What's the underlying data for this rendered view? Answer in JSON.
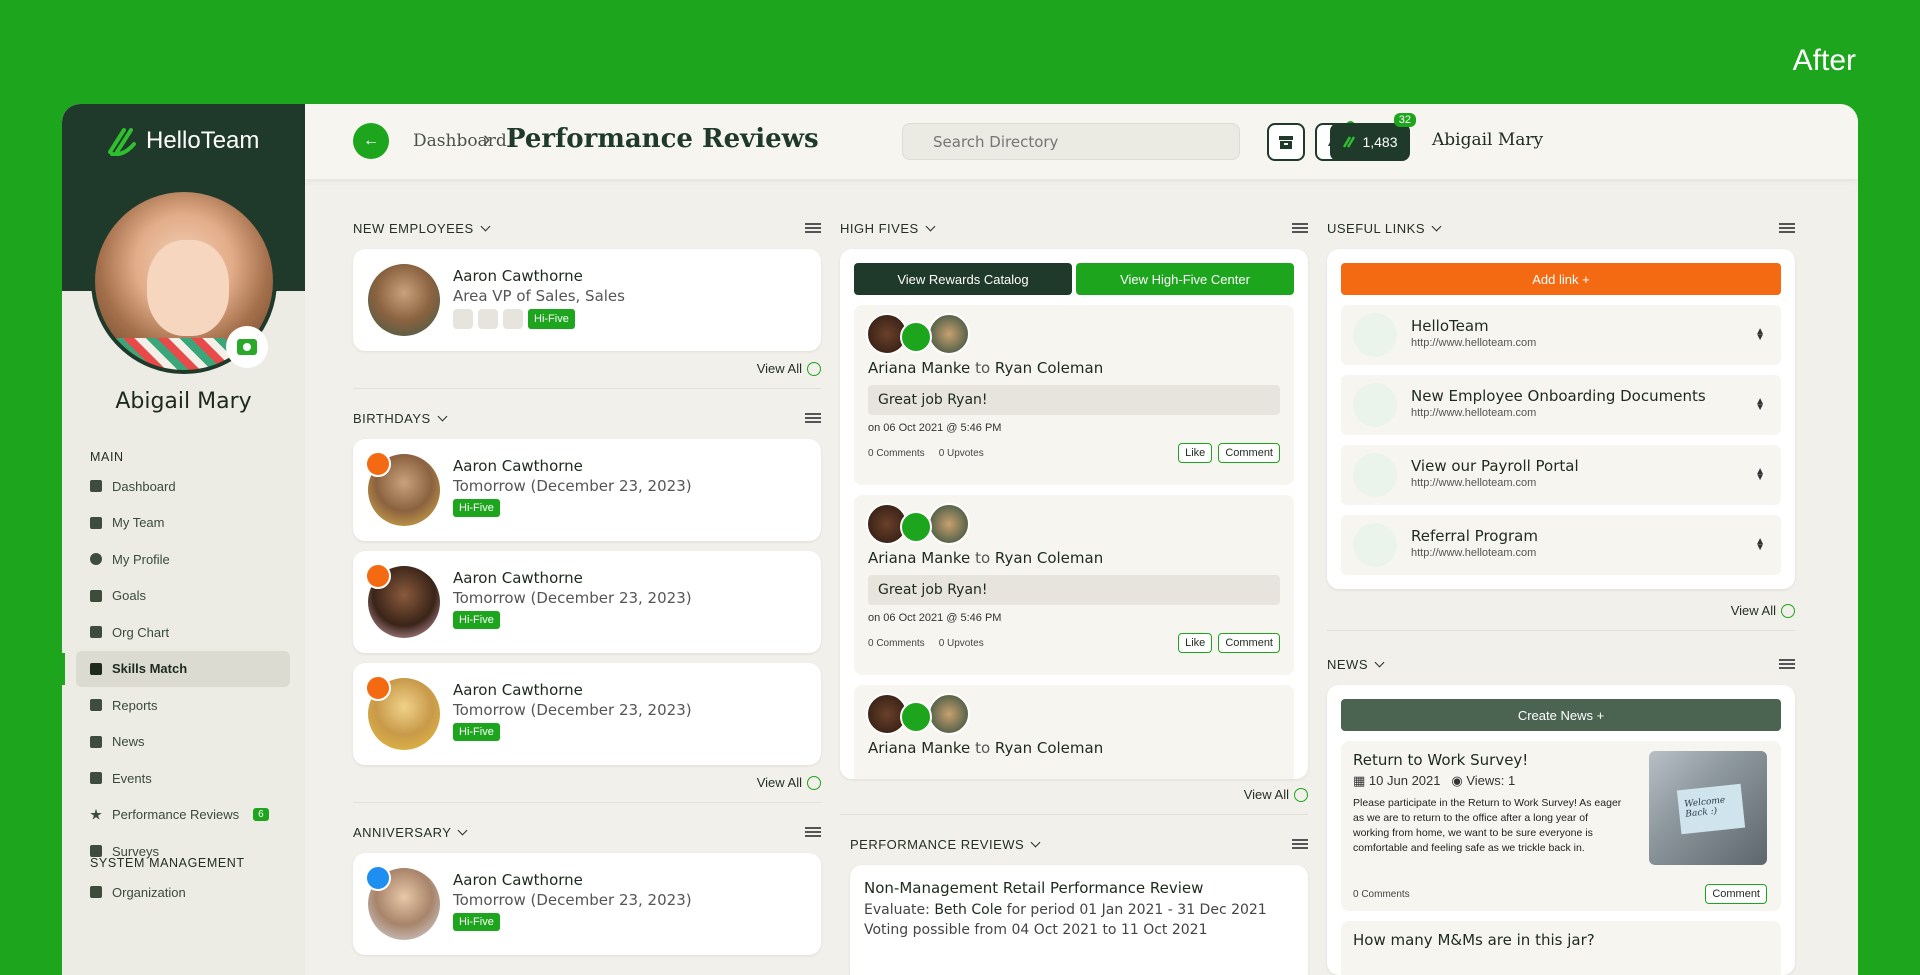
{
  "after_label": "After",
  "app": {
    "name": "HelloTeam"
  },
  "profile": {
    "name": "Abigail Mary"
  },
  "sidebar": {
    "main_title": "MAIN",
    "items": [
      {
        "label": "Dashboard",
        "icon": "home-icon"
      },
      {
        "label": "My Team",
        "icon": "team-icon"
      },
      {
        "label": "My Profile",
        "icon": "profile-icon"
      },
      {
        "label": "Goals",
        "icon": "flag-icon"
      },
      {
        "label": "Org Chart",
        "icon": "org-chart-icon"
      },
      {
        "label": "Skills Match",
        "icon": "puzzle-icon",
        "active": true
      },
      {
        "label": "Reports",
        "icon": "report-icon"
      },
      {
        "label": "News",
        "icon": "megaphone-icon"
      },
      {
        "label": "Events",
        "icon": "calendar-icon"
      },
      {
        "label": "Performance Reviews",
        "icon": "star-icon",
        "badge": "6"
      },
      {
        "label": "Surveys",
        "icon": "survey-icon"
      }
    ],
    "system_title": "SYSTEM MANAGEMENT",
    "system_items": [
      {
        "label": "Organization",
        "icon": "home-icon"
      }
    ]
  },
  "topbar": {
    "breadcrumb": "Dashboard",
    "title": "Performance Reviews",
    "search_placeholder": "Search Directory",
    "points": "1,483",
    "points_badge": "32",
    "user": "Abigail Mary"
  },
  "new_employees": {
    "title": "NEW EMPLOYEES",
    "person": {
      "name": "Aaron Cawthorne",
      "role": "Area VP of Sales, Sales",
      "hifive": "Hi-Five"
    },
    "view_all": "View All"
  },
  "birthdays": {
    "title": "BIRTHDAYS",
    "people": [
      {
        "name": "Aaron Cawthorne",
        "when": "Tomorrow (December 23, 2023)",
        "hifive": "Hi-Five"
      },
      {
        "name": "Aaron Cawthorne",
        "when": "Tomorrow (December 23, 2023)",
        "hifive": "Hi-Five"
      },
      {
        "name": "Aaron Cawthorne",
        "when": "Tomorrow (December 23, 2023)",
        "hifive": "Hi-Five"
      }
    ],
    "view_all": "View All"
  },
  "anniversary": {
    "title": "ANNIVERSARY",
    "person": {
      "name": "Aaron Cawthorne",
      "when": "Tomorrow (December 23, 2023)",
      "hifive": "Hi-Five"
    }
  },
  "high_fives": {
    "title": "HIGH FIVES",
    "btn_rewards": "View Rewards Catalog",
    "btn_center": "View High-Five Center",
    "items": [
      {
        "from": "Ariana Manke",
        "to": "Ryan Coleman",
        "message": "Great job Ryan!",
        "date": "on 06 Oct 2021 @ 5:46 PM",
        "comments": "0 Comments",
        "upvotes": "0 Upvotes"
      },
      {
        "from": "Ariana Manke",
        "to": "Ryan Coleman",
        "message": "Great job Ryan!",
        "date": "on 06 Oct 2021 @ 5:46 PM",
        "comments": "0 Comments",
        "upvotes": "0 Upvotes"
      },
      {
        "from": "Ariana Manke",
        "to": "Ryan Coleman"
      }
    ],
    "to_word": "to",
    "like": "Like",
    "comment": "Comment",
    "view_all": "View All"
  },
  "performance_reviews": {
    "title": "PERFORMANCE REVIEWS",
    "review_title": "Non-Management Retail Performance Review",
    "evaluate_prefix": "Evaluate:",
    "evaluate_name": "Beth Cole",
    "evaluate_suffix": "for period 01 Jan 2021 - 31 Dec 2021",
    "voting": "Voting possible from 04 Oct 2021 to 11 Oct 2021"
  },
  "useful_links": {
    "title": "USEFUL LINKS",
    "add": "Add link +",
    "links": [
      {
        "title": "HelloTeam",
        "url": "http://www.helloteam.com"
      },
      {
        "title": "New Employee Onboarding Documents",
        "url": "http://www.helloteam.com"
      },
      {
        "title": "View our Payroll Portal",
        "url": "http://www.helloteam.com"
      },
      {
        "title": "Referral Program",
        "url": "http://www.helloteam.com"
      }
    ],
    "view_all": "View All"
  },
  "news": {
    "title": "NEWS",
    "create": "Create News +",
    "item_title": "Return to Work Survey!",
    "item_date": "10 Jun 2021",
    "item_views": "Views: 1",
    "item_body": "Please participate in the Return to Work Survey! As eager as we are to return to the office after a long year of working from home, we want to be sure everyone is comfortable and feeling safe as we trickle back in.",
    "item_comments": "0 Comments",
    "comment": "Comment",
    "next_title": "How many M&Ms are in this jar?",
    "img_caption": "Welcome Back :)"
  },
  "colors": {
    "accent": "#1ea51e",
    "dark": "#1f3a2a",
    "orange": "#f46a12",
    "slate": "#4b6452"
  }
}
